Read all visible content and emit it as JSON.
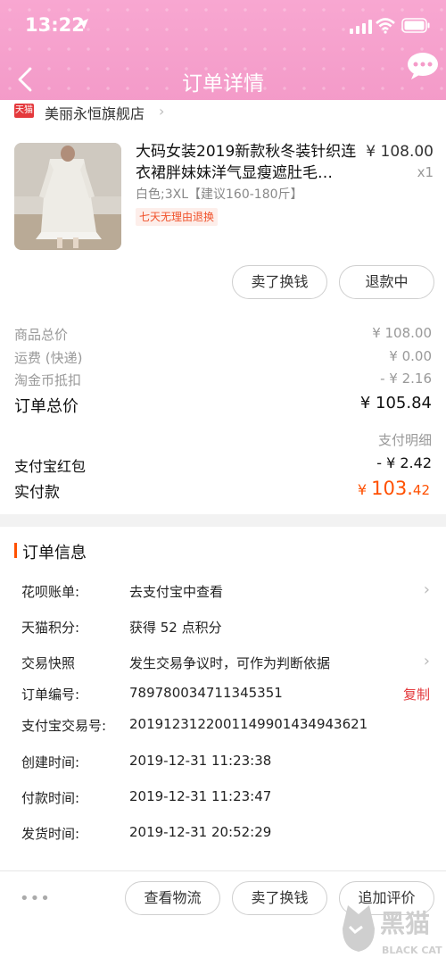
{
  "status_bar": {
    "time": "13:22"
  },
  "header": {
    "title": "订单详情"
  },
  "shop": {
    "badge": "天猫",
    "name": "美丽永恒旗舰店",
    "chevron": "›"
  },
  "product": {
    "title": "大码女装2019新款秋冬装针织连衣裙胖妹妹洋气显瘦遮肚毛…",
    "price": "¥ 108.00",
    "qty": "x1",
    "sku": "白色;3XL【建议160-180斤】",
    "tag": "七天无理由退换",
    "buttons": {
      "exchange": "卖了换钱",
      "refund": "退款中"
    }
  },
  "price_summary": {
    "goods_total_label": "商品总价",
    "goods_total": "¥ 108.00",
    "shipping_label": "运费 (快递)",
    "shipping": "¥ 0.00",
    "coins_label": "淘金币抵扣",
    "coins": "- ¥ 2.16",
    "order_total_label": "订单总价",
    "order_total": "¥ 105.84",
    "pay_detail": "支付明细",
    "alipay_redpacket_label": "支付宝红包",
    "alipay_redpacket": "- ¥ 2.42",
    "actual_label": "实付款",
    "actual_currency": "¥ ",
    "actual_int": "103.",
    "actual_dec": "42"
  },
  "order_info": {
    "section_title": "订单信息",
    "rows": [
      {
        "label": "花呗账单:",
        "value": "去支付宝中查看"
      },
      {
        "label": "天猫积分:",
        "value": "获得 52 点积分"
      },
      {
        "label": "交易快照",
        "value": "发生交易争议时，可作为判断依据"
      },
      {
        "label": "订单编号:",
        "value": "789780034711345351"
      },
      {
        "label": "支付宝交易号:",
        "value": "2019123122001149901434943621"
      },
      {
        "label": "创建时间:",
        "value": "2019-12-31 11:23:38"
      },
      {
        "label": "付款时间:",
        "value": "2019-12-31 11:23:47"
      },
      {
        "label": "发货时间:",
        "value": "2019-12-31 20:52:29"
      }
    ],
    "copy": "复制"
  },
  "bottom_bar": {
    "more": "•••",
    "logistics": "查看物流",
    "exchange": "卖了换钱",
    "review": "追加评价"
  },
  "watermark": {
    "cn": "黑猫",
    "en": "BLACK CAT"
  },
  "colors": {
    "accent": "#ff5000",
    "header_pink": "#f59bc9",
    "copy_red": "#e4393c"
  }
}
